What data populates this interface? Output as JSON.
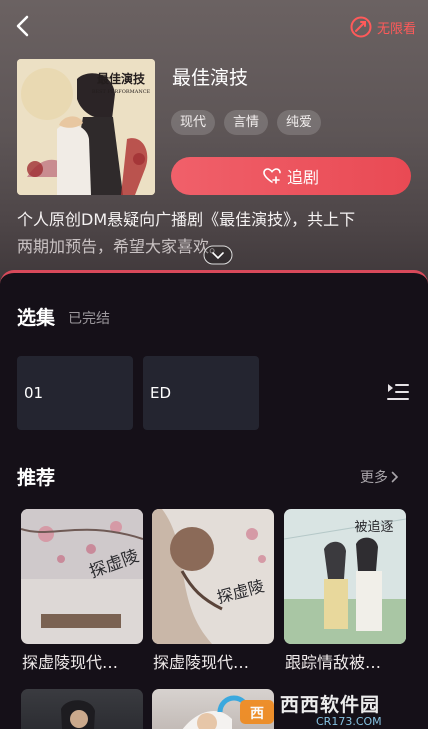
{
  "header": {
    "nolimit_label": "无限看"
  },
  "drama": {
    "title": "最佳演技",
    "tags": [
      "现代",
      "言情",
      "纯爱"
    ],
    "follow_label": "追剧",
    "description_line1": "个人原创DM悬疑向广播剧《最佳演技》，共上下",
    "description_line2": "两期加预告，希望大家喜欢。",
    "cover_title": "最佳演技",
    "cover_subtitle": "BEST PERFORMANCE"
  },
  "episodes": {
    "title": "选集",
    "status": "已完结",
    "items": [
      "01",
      "ED"
    ]
  },
  "recommend": {
    "title": "推荐",
    "more_label": "更多",
    "items": [
      {
        "label": "探虚陵现代…",
        "cover_text": "探虚陵"
      },
      {
        "label": "探虚陵现代…",
        "cover_text": "探虚陵"
      },
      {
        "label": "跟踪情敌被…",
        "cover_text": "被追逐"
      }
    ]
  },
  "watermark": {
    "text": "西西软件园",
    "url": "CR173.COM"
  },
  "colors": {
    "accent": "#e94a54",
    "nolimit": "#ff5a5a",
    "panel_bg": "#151018",
    "episode_bg": "#242530"
  }
}
